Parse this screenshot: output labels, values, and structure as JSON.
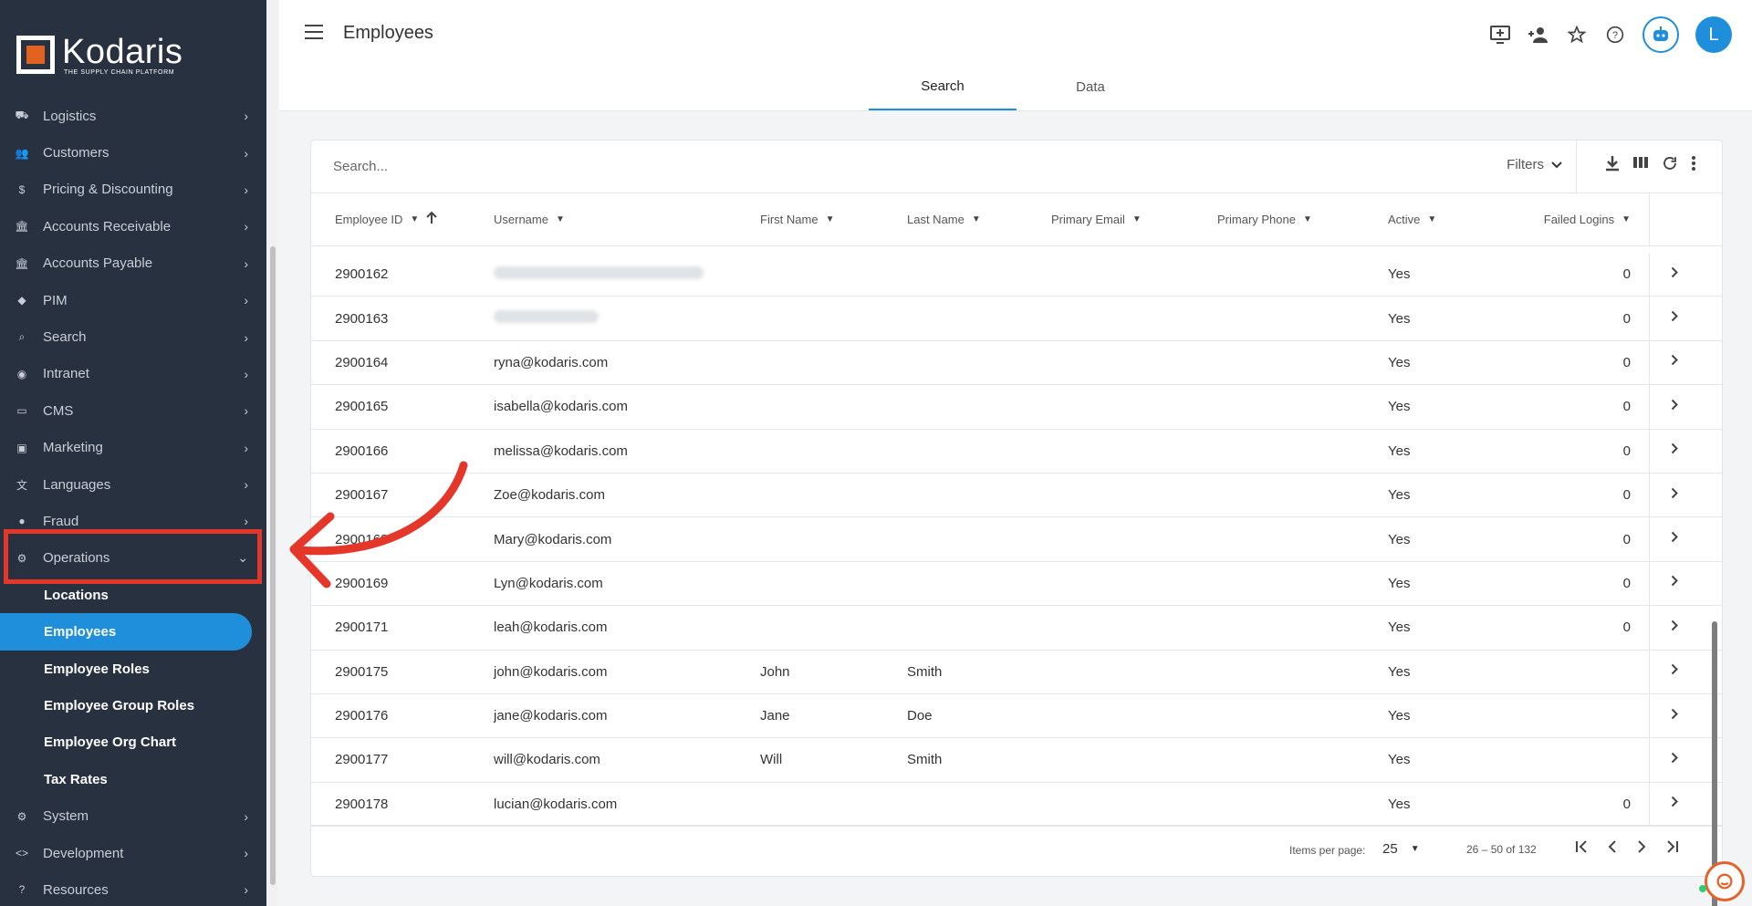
{
  "sidebar": {
    "brand": "Kodaris",
    "tagline": "THE SUPPLY CHAIN PLATFORM",
    "items": [
      {
        "label": "Logistics",
        "icon": "truck-icon"
      },
      {
        "label": "Customers",
        "icon": "people-icon"
      },
      {
        "label": "Pricing & Discounting",
        "icon": "dollar-icon"
      },
      {
        "label": "Accounts Receivable",
        "icon": "bank-icon"
      },
      {
        "label": "Accounts Payable",
        "icon": "bank-icon"
      },
      {
        "label": "PIM",
        "icon": "tag-icon"
      },
      {
        "label": "Search",
        "icon": "search-icon"
      },
      {
        "label": "Intranet",
        "icon": "hub-icon"
      },
      {
        "label": "CMS",
        "icon": "web-icon"
      },
      {
        "label": "Marketing",
        "icon": "campaign-icon"
      },
      {
        "label": "Languages",
        "icon": "translate-icon"
      },
      {
        "label": "Fraud",
        "icon": "alert-icon"
      },
      {
        "label": "Operations",
        "icon": "gear-hand-icon"
      }
    ],
    "sub_items": [
      {
        "label": "Locations"
      },
      {
        "label": "Employees"
      },
      {
        "label": "Employee Roles"
      },
      {
        "label": "Employee Group Roles"
      },
      {
        "label": "Employee Org Chart"
      },
      {
        "label": "Tax Rates"
      }
    ],
    "bottom_items": [
      {
        "label": "System",
        "icon": "settings-icon"
      },
      {
        "label": "Development",
        "icon": "code-icon"
      },
      {
        "label": "Resources",
        "icon": "help-icon"
      }
    ]
  },
  "header": {
    "title": "Employees",
    "avatar_initial": "L",
    "tabs": [
      "Search",
      "Data"
    ]
  },
  "search": {
    "placeholder": "Search...",
    "filters_label": "Filters"
  },
  "table": {
    "columns": [
      "Employee ID",
      "Username",
      "First Name",
      "Last Name",
      "Primary Email",
      "Primary Phone",
      "Active",
      "Failed Logins"
    ],
    "rows": [
      {
        "id": "2900162",
        "username": "",
        "first": "",
        "last": "",
        "active": "Yes",
        "failed": "0",
        "blurred": true
      },
      {
        "id": "2900163",
        "username": "",
        "first": "",
        "last": "",
        "active": "Yes",
        "failed": "0",
        "blurred": true
      },
      {
        "id": "2900164",
        "username": "ryna@kodaris.com",
        "first": "",
        "last": "",
        "active": "Yes",
        "failed": "0"
      },
      {
        "id": "2900165",
        "username": "isabella@kodaris.com",
        "first": "",
        "last": "",
        "active": "Yes",
        "failed": "0"
      },
      {
        "id": "2900166",
        "username": "melissa@kodaris.com",
        "first": "",
        "last": "",
        "active": "Yes",
        "failed": "0"
      },
      {
        "id": "2900167",
        "username": "Zoe@kodaris.com",
        "first": "",
        "last": "",
        "active": "Yes",
        "failed": "0"
      },
      {
        "id": "2900168",
        "username": "Mary@kodaris.com",
        "first": "",
        "last": "",
        "active": "Yes",
        "failed": "0"
      },
      {
        "id": "2900169",
        "username": "Lyn@kodaris.com",
        "first": "",
        "last": "",
        "active": "Yes",
        "failed": "0"
      },
      {
        "id": "2900171",
        "username": "leah@kodaris.com",
        "first": "",
        "last": "",
        "active": "Yes",
        "failed": "0"
      },
      {
        "id": "2900175",
        "username": "john@kodaris.com",
        "first": "John",
        "last": "Smith",
        "active": "Yes",
        "failed": ""
      },
      {
        "id": "2900176",
        "username": "jane@kodaris.com",
        "first": "Jane",
        "last": "Doe",
        "active": "Yes",
        "failed": ""
      },
      {
        "id": "2900177",
        "username": "will@kodaris.com",
        "first": "Will",
        "last": "Smith",
        "active": "Yes",
        "failed": ""
      },
      {
        "id": "2900178",
        "username": "lucian@kodaris.com",
        "first": "",
        "last": "",
        "active": "Yes",
        "failed": "0"
      }
    ]
  },
  "pager": {
    "items_per_page_label": "Items per page:",
    "items_per_page": "25",
    "range": "26 – 50 of 132"
  },
  "colors": {
    "accent": "#1f8fdb",
    "sidebar_bg": "#283140",
    "annotation": "#e5362a"
  }
}
